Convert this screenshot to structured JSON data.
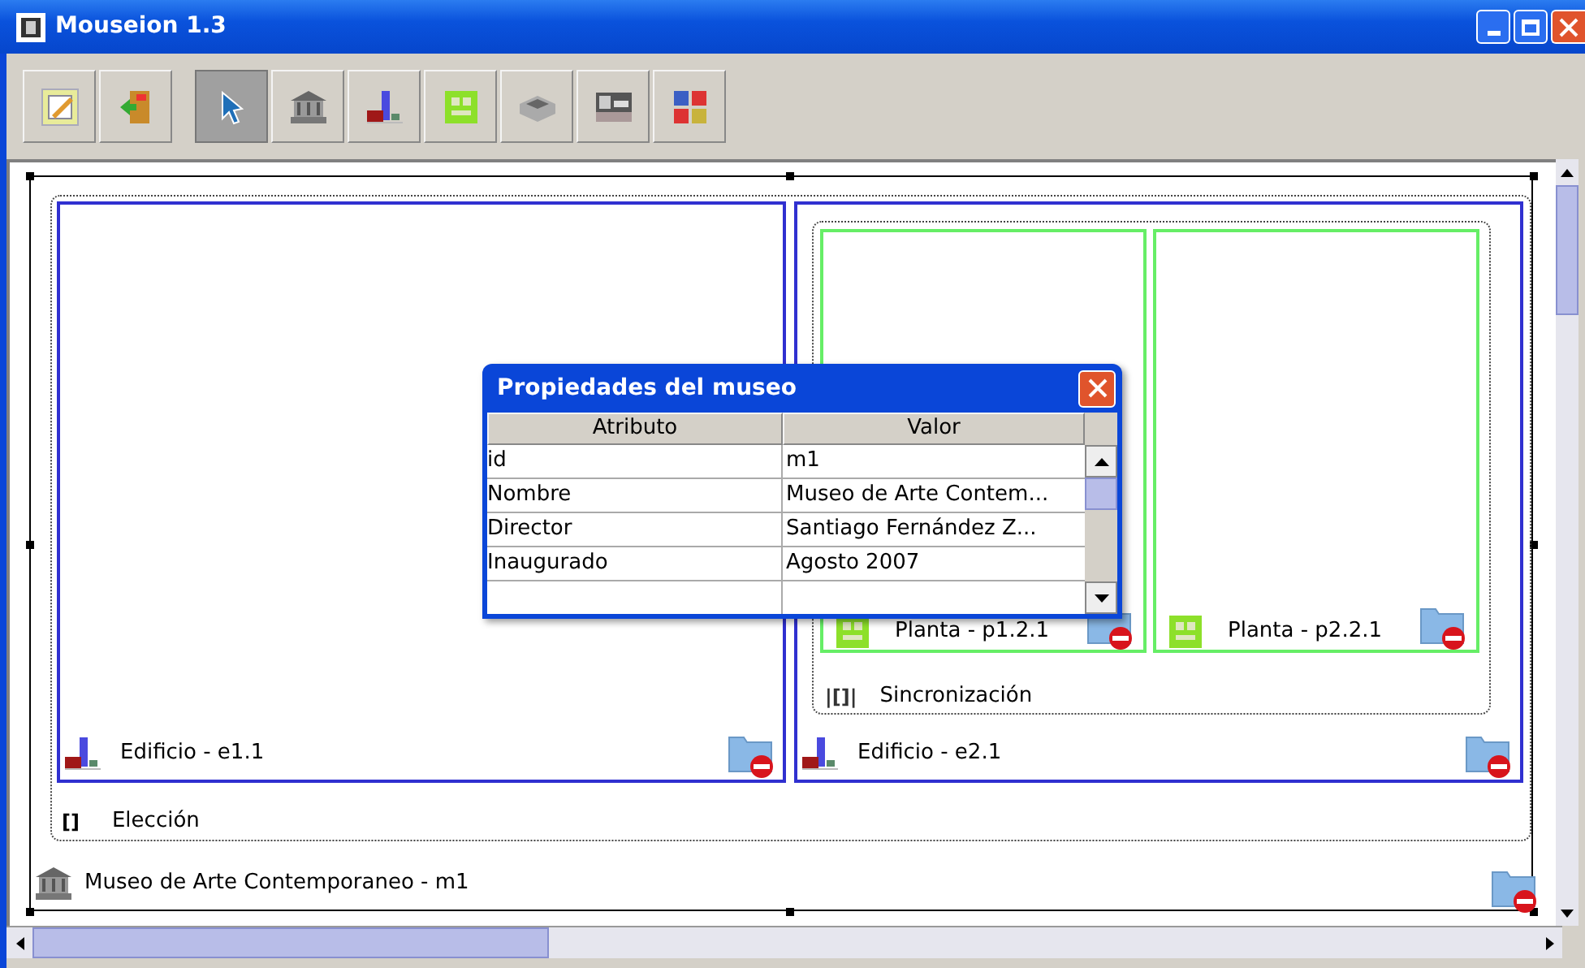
{
  "window": {
    "title": "Mouseion 1.3"
  },
  "toolbar": {
    "tools": [
      {
        "kind": "edit",
        "selected": false
      },
      {
        "kind": "exit",
        "selected": false
      },
      {
        "kind": "pointer",
        "selected": true
      },
      {
        "kind": "museum",
        "selected": false
      },
      {
        "kind": "building",
        "selected": false
      },
      {
        "kind": "floor",
        "selected": false
      },
      {
        "kind": "room",
        "selected": false
      },
      {
        "kind": "exhibit",
        "selected": false
      },
      {
        "kind": "images",
        "selected": false
      }
    ]
  },
  "diagram": {
    "museum": {
      "label": "Museo de Arte Contemporaneo - m1"
    },
    "choice": {
      "marker": "[]",
      "label": "Elección"
    },
    "buildings": [
      {
        "label": "Edificio  - e1.1"
      },
      {
        "label": "Edificio  - e2.1"
      }
    ],
    "sync": {
      "marker": "|[]|",
      "label": "Sincronización"
    },
    "floors": [
      {
        "label": "Planta  - p1.2.1"
      },
      {
        "label": "Planta  - p2.2.1"
      }
    ]
  },
  "dialog": {
    "title": "Propiedades del museo",
    "columns": [
      "Atributo",
      "Valor"
    ],
    "rows": [
      {
        "attribute": "id",
        "value": "m1"
      },
      {
        "attribute": "Nombre",
        "value": "Museo de Arte Contem..."
      },
      {
        "attribute": "Director",
        "value": "Santiago Fernández Z..."
      },
      {
        "attribute": "Inaugurado",
        "value": "Agosto 2007"
      }
    ]
  }
}
